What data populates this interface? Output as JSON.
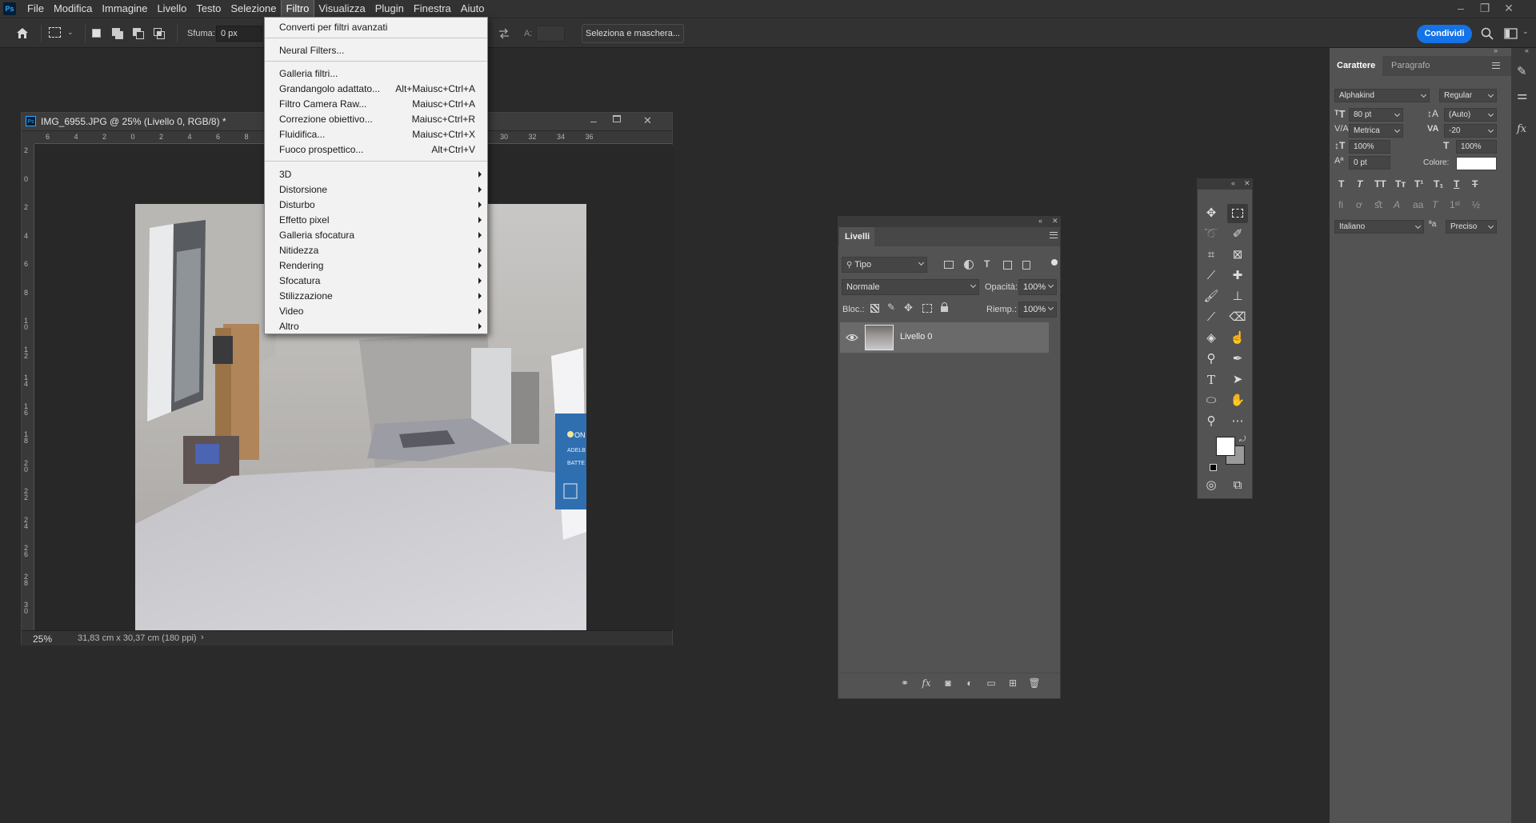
{
  "app": {
    "logo_text": "Ps"
  },
  "menubar": {
    "items": [
      "File",
      "Modifica",
      "Immagine",
      "Livello",
      "Testo",
      "Selezione",
      "Filtro",
      "Visualizza",
      "Plugin",
      "Finestra",
      "Aiuto"
    ],
    "active_index": 6
  },
  "options_bar": {
    "feather_label": "Sfuma:",
    "feather_value": "0 px",
    "height_label": "A:",
    "select_mask_label": "Seleziona e maschera...",
    "share_label": "Condividi"
  },
  "filter_menu": {
    "group1": [
      {
        "label": "Converti per filtri avanzati",
        "shortcut": ""
      }
    ],
    "group2": [
      {
        "label": "Neural Filters...",
        "shortcut": ""
      }
    ],
    "group3": [
      {
        "label": "Galleria filtri...",
        "shortcut": ""
      },
      {
        "label": "Grandangolo adattato...",
        "shortcut": "Alt+Maiusc+Ctrl+A"
      },
      {
        "label": "Filtro Camera Raw...",
        "shortcut": "Maiusc+Ctrl+A"
      },
      {
        "label": "Correzione obiettivo...",
        "shortcut": "Maiusc+Ctrl+R"
      },
      {
        "label": "Fluidifica...",
        "shortcut": "Maiusc+Ctrl+X"
      },
      {
        "label": "Fuoco prospettico...",
        "shortcut": "Alt+Ctrl+V"
      }
    ],
    "submenus": [
      "3D",
      "Distorsione",
      "Disturbo",
      "Effetto pixel",
      "Galleria sfocatura",
      "Nitidezza",
      "Rendering",
      "Sfocatura",
      "Stilizzazione",
      "Video",
      "Altro"
    ]
  },
  "document": {
    "title": "IMG_6955.JPG @ 25% (Livello 0, RGB/8) *",
    "icon_text": "Ps",
    "zoom": "25%",
    "size_info": "31,83 cm x 30,37 cm (180 ppi)",
    "ruler_h": [
      "6",
      "4",
      "2",
      "0",
      "2",
      "4",
      "6",
      "8",
      "",
      "",
      "",
      "",
      "",
      "",
      "26",
      "28",
      "30",
      "32",
      "34",
      "36"
    ],
    "ruler_v": [
      "2",
      "0",
      "2",
      "4",
      "6",
      "8",
      "1 0",
      "1 2",
      "1 4",
      "1 6",
      "1 8",
      "2 0",
      "2 2",
      "2 4",
      "2 6",
      "2 8",
      "3 0"
    ],
    "photo_labels": {
      "on": "ON",
      "line1": "ADELB",
      "line2": "BATTE"
    }
  },
  "layers_panel": {
    "tab_label": "Livelli",
    "filter_kind": "Tipo",
    "blend_mode": "Normale",
    "opacity_label": "Opacità:",
    "opacity_value": "100%",
    "lock_label": "Bloc.:",
    "fill_label": "Riemp.:",
    "fill_value": "100%",
    "layers": [
      {
        "name": "Livello 0",
        "visible": true
      }
    ]
  },
  "toolbar": {
    "foreground_color": "#ffffff",
    "background_color": "#9a9a9a"
  },
  "character_panel": {
    "tab_active": "Carattere",
    "tab_inactive": "Paragrafo",
    "font_family": "Alphakind",
    "font_style": "Regular",
    "font_size": "80 pt",
    "leading": "(Auto)",
    "kerning": "Metrica",
    "tracking": "-20",
    "vertical_scale": "100%",
    "horizontal_scale": "100%",
    "baseline_shift": "0 pt",
    "color_label": "Colore:",
    "color_value": "#ffffff",
    "language": "Italiano",
    "antialias": "Preciso",
    "aa_glyph": "ªa"
  }
}
